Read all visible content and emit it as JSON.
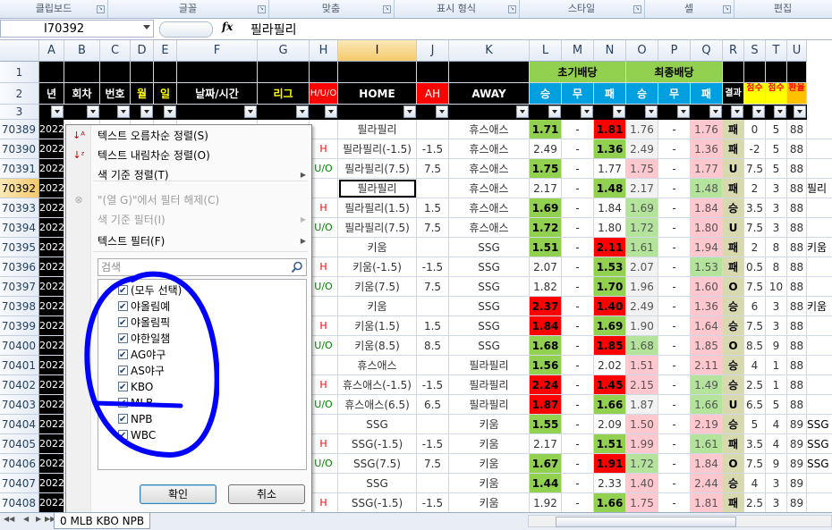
{
  "ribbon_groups": [
    "클립보드",
    "글꼴",
    "맞춤",
    "표시 형식",
    "스타일",
    "셀",
    "편집"
  ],
  "formula_bar": {
    "name_box": "I70392",
    "fx": "fx",
    "formula": "필라필리"
  },
  "columns": [
    "A",
    "B",
    "C",
    "D",
    "E",
    "F",
    "G",
    "H",
    "I",
    "J",
    "K",
    "L",
    "M",
    "N",
    "O",
    "P",
    "Q",
    "R",
    "S",
    "T",
    "U"
  ],
  "row_numbers": [
    "1",
    "2",
    "3"
  ],
  "header_row1": {
    "initial_odds": "초기배당",
    "final_odds": "최종배당"
  },
  "header_row2": [
    "년",
    "회차",
    "번호",
    "월",
    "일",
    "날짜/시간",
    "리그",
    "H/U/O",
    "HOME",
    "AH",
    "AWAY",
    "승",
    "무",
    "패",
    "승",
    "무",
    "패",
    "결과",
    "점수",
    "점수",
    "환율"
  ],
  "data_rows": [
    {
      "rownum": "70389",
      "year": "2022",
      "h": "",
      "home": "필라필리",
      "ah": "",
      "away": "휴스애스",
      "l": "1.71",
      "m": "-",
      "n": "1.81",
      "o": "1.76",
      "p": "-",
      "q": "1.76",
      "r": "패",
      "s": "0",
      "t": "5",
      "u": "88"
    },
    {
      "rownum": "70390",
      "year": "2022",
      "h": "H",
      "home": "필라필리(-1.5)",
      "ah": "-1.5",
      "away": "휴스애스",
      "l": "2.49",
      "m": "-",
      "n": "1.36",
      "o": "2.49",
      "p": "-",
      "q": "1.36",
      "r": "패",
      "s": "-2",
      "t": "5",
      "u": "88"
    },
    {
      "rownum": "70391",
      "year": "2022",
      "h": "U/O",
      "home": "필라필리(7.5)",
      "ah": "7.5",
      "away": "휴스애스",
      "l": "1.75",
      "m": "-",
      "n": "1.77",
      "o": "1.75",
      "p": "-",
      "q": "1.77",
      "r": "U",
      "s": "7.5",
      "t": "5",
      "u": "88"
    },
    {
      "rownum": "70392",
      "year": "2022",
      "h": "",
      "home": "필라필리",
      "ah": "",
      "away": "휴스애스",
      "l": "2.17",
      "m": "-",
      "n": "1.48",
      "o": "2.17",
      "p": "-",
      "q": "1.48",
      "r": "패",
      "s": "2",
      "t": "3",
      "u": "88"
    },
    {
      "rownum": "70393",
      "year": "2022",
      "h": "H",
      "home": "필라필리(1.5)",
      "ah": "1.5",
      "away": "휴스애스",
      "l": "1.69",
      "m": "-",
      "n": "1.84",
      "o": "1.69",
      "p": "-",
      "q": "1.84",
      "r": "승",
      "s": "3.5",
      "t": "3",
      "u": "88"
    },
    {
      "rownum": "70394",
      "year": "2022",
      "h": "U/O",
      "home": "필라필리(7.5)",
      "ah": "7.5",
      "away": "휴스애스",
      "l": "1.72",
      "m": "-",
      "n": "1.80",
      "o": "1.72",
      "p": "-",
      "q": "1.80",
      "r": "U",
      "s": "7.5",
      "t": "3",
      "u": "88"
    },
    {
      "rownum": "70395",
      "year": "2022",
      "h": "",
      "home": "키움",
      "ah": "",
      "away": "SSG",
      "l": "1.51",
      "m": "-",
      "n": "2.11",
      "o": "1.61",
      "p": "-",
      "q": "1.94",
      "r": "패",
      "s": "2",
      "t": "8",
      "u": "88"
    },
    {
      "rownum": "70396",
      "year": "2022",
      "h": "H",
      "home": "키움(-1.5)",
      "ah": "-1.5",
      "away": "SSG",
      "l": "2.07",
      "m": "-",
      "n": "1.53",
      "o": "2.07",
      "p": "-",
      "q": "1.53",
      "r": "패",
      "s": "0.5",
      "t": "8",
      "u": "88"
    },
    {
      "rownum": "70397",
      "year": "2022",
      "h": "U/O",
      "home": "키움(7.5)",
      "ah": "7.5",
      "away": "SSG",
      "l": "1.82",
      "m": "-",
      "n": "1.70",
      "o": "1.96",
      "p": "-",
      "q": "1.60",
      "r": "O",
      "s": "7.5",
      "t": "10",
      "u": "88"
    },
    {
      "rownum": "70398",
      "year": "2022",
      "h": "",
      "home": "키움",
      "ah": "",
      "away": "SSG",
      "l": "2.37",
      "m": "-",
      "n": "1.40",
      "o": "2.49",
      "p": "-",
      "q": "1.36",
      "r": "승",
      "s": "6",
      "t": "3",
      "u": "88"
    },
    {
      "rownum": "70399",
      "year": "2022",
      "h": "H",
      "home": "키움(1.5)",
      "ah": "1.5",
      "away": "SSG",
      "l": "1.84",
      "m": "-",
      "n": "1.69",
      "o": "1.90",
      "p": "-",
      "q": "1.64",
      "r": "승",
      "s": "7.5",
      "t": "3",
      "u": "88"
    },
    {
      "rownum": "70400",
      "year": "2022",
      "h": "U/O",
      "home": "키움(8.5)",
      "ah": "8.5",
      "away": "SSG",
      "l": "1.68",
      "m": "-",
      "n": "1.85",
      "o": "1.68",
      "p": "-",
      "q": "1.85",
      "r": "O",
      "s": "8.5",
      "t": "9",
      "u": "88"
    },
    {
      "rownum": "70401",
      "year": "2022",
      "h": "",
      "home": "휴스애스",
      "ah": "",
      "away": "필라필리",
      "l": "1.56",
      "m": "-",
      "n": "2.02",
      "o": "1.51",
      "p": "-",
      "q": "2.11",
      "r": "승",
      "s": "4",
      "t": "1",
      "u": "88"
    },
    {
      "rownum": "70402",
      "year": "2022",
      "h": "H",
      "home": "휴스애스(-1.5)",
      "ah": "-1.5",
      "away": "필라필리",
      "l": "2.24",
      "m": "-",
      "n": "1.45",
      "o": "2.15",
      "p": "-",
      "q": "1.49",
      "r": "승",
      "s": "2.5",
      "t": "1",
      "u": "88"
    },
    {
      "rownum": "70403",
      "year": "2022",
      "h": "U/O",
      "home": "휴스애스(6.5)",
      "ah": "6.5",
      "away": "필라필리",
      "l": "1.87",
      "m": "-",
      "n": "1.66",
      "o": "1.87",
      "p": "-",
      "q": "1.66",
      "r": "U",
      "s": "6.5",
      "t": "5",
      "u": "88"
    },
    {
      "rownum": "70404",
      "year": "2022",
      "h": "",
      "home": "SSG",
      "ah": "",
      "away": "키움",
      "l": "1.55",
      "m": "-",
      "n": "2.09",
      "o": "1.50",
      "p": "-",
      "q": "2.19",
      "r": "승",
      "s": "5",
      "t": "4",
      "u": "89"
    },
    {
      "rownum": "70405",
      "year": "2022",
      "h": "H",
      "home": "SSG(-1.5)",
      "ah": "-1.5",
      "away": "키움",
      "l": "2.17",
      "m": "-",
      "n": "1.51",
      "o": "1.99",
      "p": "-",
      "q": "1.61",
      "r": "패",
      "s": "3.5",
      "t": "4",
      "u": "89"
    },
    {
      "rownum": "70406",
      "year": "2022",
      "h": "U/O",
      "home": "SSG(7.5)",
      "ah": "7.5",
      "away": "키움",
      "l": "1.67",
      "m": "-",
      "n": "1.91",
      "o": "1.72",
      "p": "-",
      "q": "1.84",
      "r": "O",
      "s": "7.5",
      "t": "9",
      "u": "89"
    },
    {
      "rownum": "70407",
      "year": "2022",
      "h": "",
      "home": "SSG",
      "ah": "",
      "away": "키움",
      "l": "1.44",
      "m": "-",
      "n": "2.33",
      "o": "1.40",
      "p": "-",
      "q": "2.44",
      "r": "승",
      "s": "4",
      "t": "3",
      "u": "89"
    },
    {
      "rownum": "70408",
      "year": "2022",
      "h": "H",
      "home": "SSG(-1.5)",
      "ah": "-1.5",
      "away": "키움",
      "l": "1.92",
      "m": "-",
      "n": "1.66",
      "o": "1.75",
      "p": "-",
      "q": "1.81",
      "r": "패",
      "s": "2.5",
      "t": "3",
      "u": "89"
    }
  ],
  "extra_col_v": {
    "70395": "키움",
    "70398": "키움",
    "70404": "SSG",
    "70405": "SSG",
    "70406": "SSG",
    "70392": "필리"
  },
  "filter_menu": {
    "items": [
      {
        "label": "텍스트 오름차순 정렬(S)",
        "icon": "sort-asc-icon",
        "disabled": false,
        "sub": false
      },
      {
        "label": "텍스트 내림차순 정렬(O)",
        "icon": "sort-desc-icon",
        "disabled": false,
        "sub": false
      },
      {
        "label": "색 기준 정렬(T)",
        "icon": "",
        "disabled": false,
        "sub": true
      },
      {
        "label": "\"(열 G)\"에서 필터 해제(C)",
        "icon": "clear-filter-icon",
        "disabled": true,
        "sub": false
      },
      {
        "label": "색 기준 필터(I)",
        "icon": "",
        "disabled": true,
        "sub": true
      },
      {
        "label": "텍스트 필터(F)",
        "icon": "",
        "disabled": false,
        "sub": true
      }
    ],
    "search_placeholder": "검색",
    "checklist": [
      "(모두 선택)",
      "야올림예",
      "야올림픽",
      "야한일챔",
      "AG야구",
      "AS야구",
      "KBO",
      "MLB",
      "NPB",
      "WBC"
    ],
    "ok_label": "확인",
    "cancel_label": "취소"
  },
  "sheet_tab": {
    "label": "0 MLB KBO NPB"
  },
  "colors": {
    "header_bg": "#000000",
    "home_header": "#00a0e0",
    "selected_orange": "#f4c96c",
    "red_cell": "#ff0000",
    "green_cell": "#92d050",
    "pink_cell": "#ffc7ce",
    "light_green": "#b4e39c",
    "yellow": "#ffff00",
    "annotation_blue": "#0000ff"
  }
}
